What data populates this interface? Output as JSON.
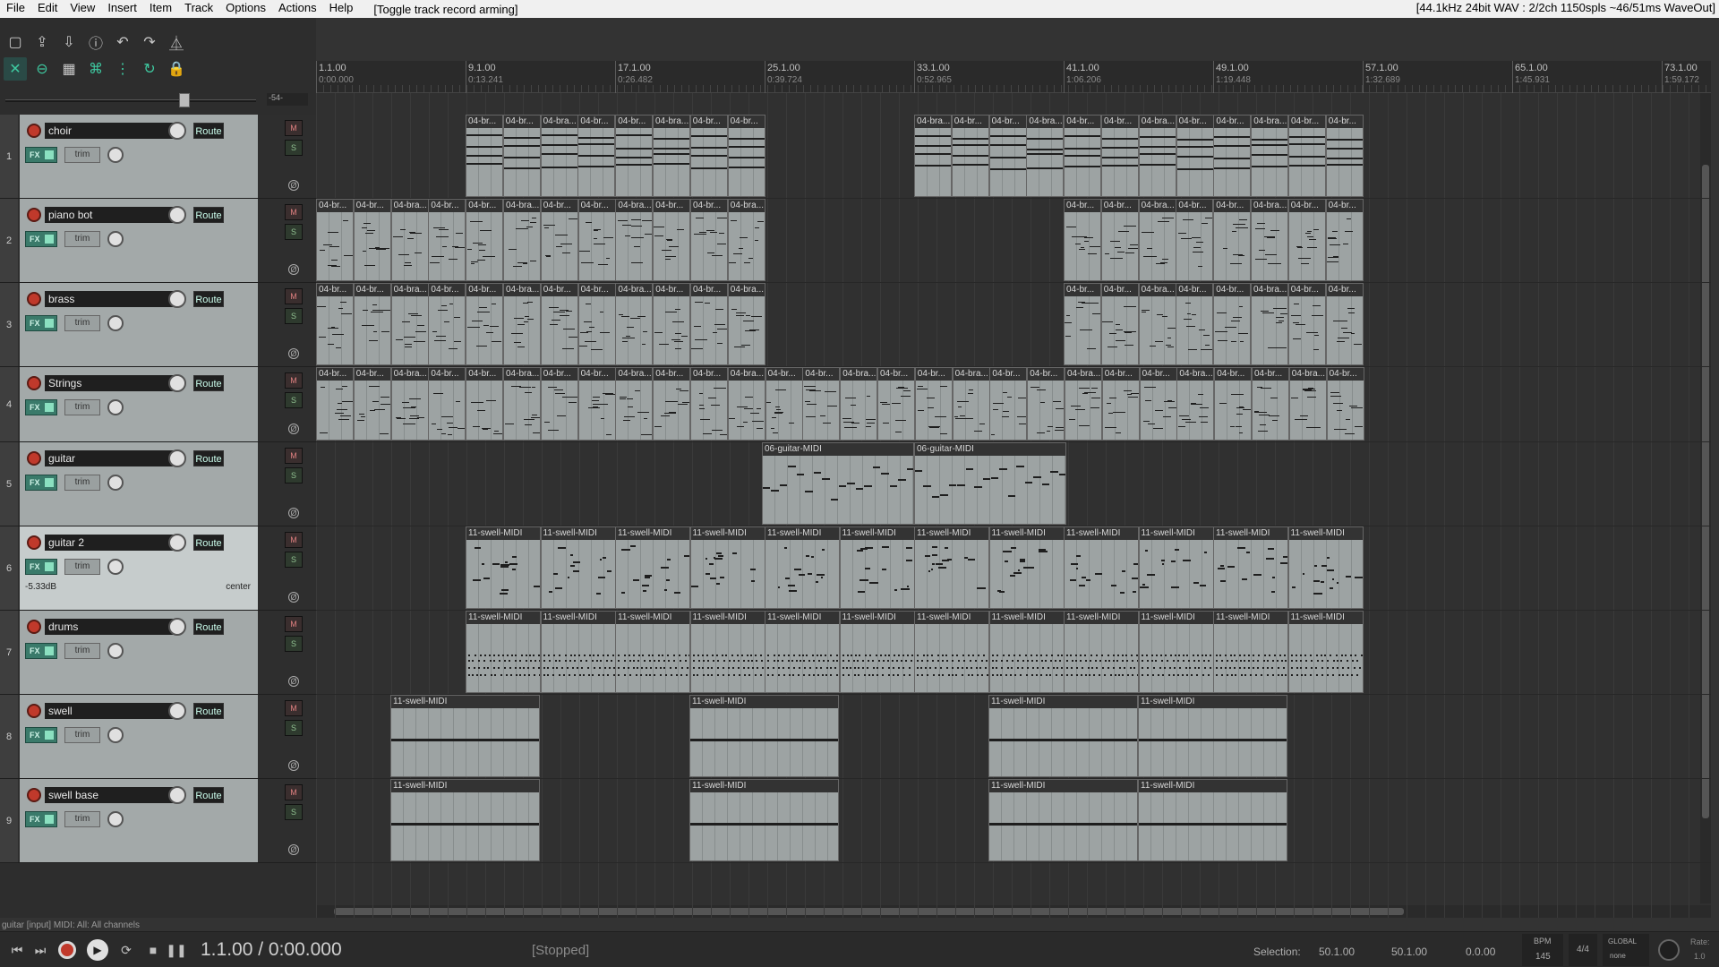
{
  "menu": {
    "items": [
      "File",
      "Edit",
      "View",
      "Insert",
      "Item",
      "Track",
      "Options",
      "Actions",
      "Help"
    ],
    "action_hint": "[Toggle track record arming]",
    "audio_status": "[44.1kHz 24bit WAV : 2/2ch 1150spls ~46/51ms WaveOut]"
  },
  "toolbar": {
    "icons": [
      "new-project",
      "open-project",
      "save-project",
      "project-info",
      "undo",
      "redo",
      "metronome",
      "ripple-edit",
      "item-grouping",
      "snap-grid",
      "envelope-link",
      "grid",
      "loop",
      "lock"
    ]
  },
  "master": {
    "volume_label": "-54-"
  },
  "ruler": {
    "markers": [
      {
        "bar": "1.1.00",
        "time": "0:00.000"
      },
      {
        "bar": "9.1.00",
        "time": "0:13.241"
      },
      {
        "bar": "17.1.00",
        "time": "0:26.482"
      },
      {
        "bar": "25.1.00",
        "time": "0:39.724"
      },
      {
        "bar": "33.1.00",
        "time": "0:52.965"
      },
      {
        "bar": "41.1.00",
        "time": "1:06.206"
      },
      {
        "bar": "49.1.00",
        "time": "1:19.448"
      },
      {
        "bar": "57.1.00",
        "time": "1:32.689"
      },
      {
        "bar": "65.1.00",
        "time": "1:45.931"
      },
      {
        "bar": "73.1.00",
        "time": "1:59.172"
      }
    ]
  },
  "track_labels": {
    "route": "Route",
    "fx": "FX",
    "trim": "trim",
    "mute": "M",
    "solo": "S",
    "phase": "Ø"
  },
  "tracks": [
    {
      "num": "1",
      "name": "choir"
    },
    {
      "num": "2",
      "name": "piano bot"
    },
    {
      "num": "3",
      "name": "brass"
    },
    {
      "num": "4",
      "name": "Strings"
    },
    {
      "num": "5",
      "name": "guitar"
    },
    {
      "num": "6",
      "name": "guitar 2",
      "volume_db": "-5.33dB",
      "pan": "center",
      "selected": true
    },
    {
      "num": "7",
      "name": "drums"
    },
    {
      "num": "8",
      "name": "swell"
    },
    {
      "num": "9",
      "name": "swell base"
    }
  ],
  "items": {
    "brass": "04-br...",
    "brass_alt": "04-bra...",
    "guitar": "06-guitar-MIDI",
    "swell": "11-swell-MIDI"
  },
  "status_line": "guitar [input] MIDI: All: All channels",
  "transport": {
    "position": "1.1.00 / 0:00.000",
    "play_state": "[Stopped]",
    "selection_label": "Selection:",
    "selection_start": "50.1.00",
    "selection_end": "50.1.00",
    "selection_length": "0.0.00",
    "bpm_label": "BPM",
    "bpm_value": "145",
    "time_sig": "4/4",
    "global_label": "GLOBAL",
    "global_value": "none",
    "rate_label": "Rate:",
    "rate_value": "1.0"
  }
}
